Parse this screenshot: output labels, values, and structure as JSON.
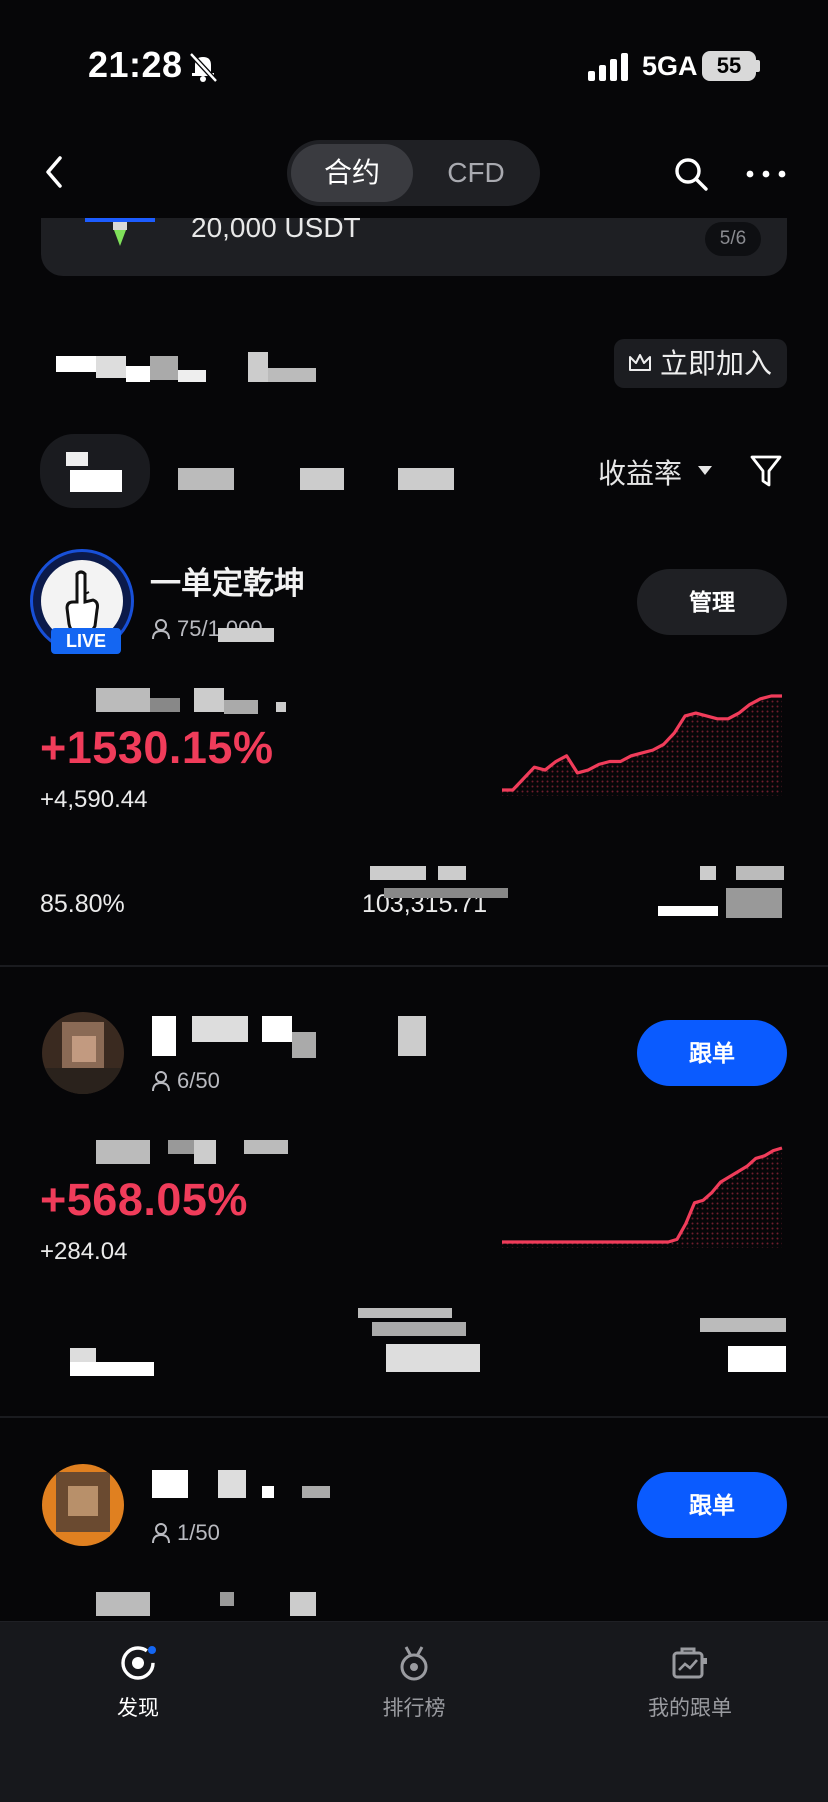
{
  "status_bar": {
    "time": "21:28",
    "network": "5GA",
    "battery": "55"
  },
  "header": {
    "tabs": [
      {
        "label": "合约",
        "active": true
      },
      {
        "label": "CFD",
        "active": false
      }
    ],
    "icons": {
      "back": "chevron-left-icon",
      "search": "search-icon",
      "more": "more-dots-icon"
    }
  },
  "banner": {
    "amount": "20,000 USDT",
    "page": "5/6"
  },
  "join_button": {
    "label": "立即加入",
    "icon": "crown-icon"
  },
  "sort": {
    "label": "收益率",
    "icon": "filter-icon"
  },
  "traders": [
    {
      "name": "一单定乾坤",
      "followers": "75/1,000",
      "live_badge": "LIVE",
      "roi": "+1530.15%",
      "pnl": "+4,590.44",
      "win_rate": "85.80%",
      "aum": "103,315.71",
      "action": "管理",
      "roi_color": "#f03c5a",
      "trend": [
        8,
        8,
        12,
        16,
        15,
        18,
        20,
        14,
        15,
        17,
        18,
        18,
        20,
        21,
        22,
        24,
        28,
        34,
        35,
        34,
        33,
        33,
        35,
        38,
        40,
        41,
        41
      ]
    },
    {
      "name": "",
      "followers": "6/50",
      "roi": "+568.05%",
      "pnl": "+284.04",
      "action": "跟单",
      "trend": [
        5,
        5,
        5,
        5,
        5,
        5,
        5,
        5,
        5,
        5,
        5,
        5,
        5,
        5,
        5,
        5,
        5,
        5,
        5,
        5,
        6,
        12,
        20,
        21,
        24,
        28,
        30,
        32,
        34,
        37,
        38,
        40,
        41
      ]
    },
    {
      "name": "",
      "followers": "1/50",
      "action": "跟单"
    }
  ],
  "bottom_nav": [
    {
      "label": "发现",
      "icon": "discover-icon",
      "active": true
    },
    {
      "label": "排行榜",
      "icon": "medal-icon",
      "active": false
    },
    {
      "label": "我的跟单",
      "icon": "copy-trade-icon",
      "active": false
    }
  ],
  "colors": {
    "accent_blue": "#0a5bff",
    "profit_red": "#f03c5a",
    "background": "#060608"
  }
}
